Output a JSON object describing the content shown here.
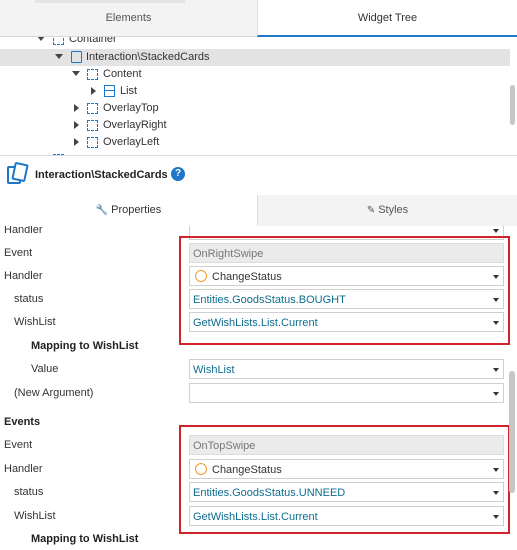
{
  "top_tabs": {
    "elements": "Elements",
    "widget_tree": "Widget Tree"
  },
  "tree": {
    "partial_top": "Container",
    "selected": "Interaction\\StackedCards",
    "content": "Content",
    "list": "List",
    "overlay_top": "OverlayTop",
    "overlay_right": "OverlayRight",
    "overlay_left": "OverlayLeft"
  },
  "widget": {
    "title": "Interaction\\StackedCards",
    "help": "?"
  },
  "prop_tabs": {
    "properties": "Properties",
    "styles": "Styles"
  },
  "props": {
    "handler_top": "Handler",
    "event1_label": "Event",
    "event1_value": "OnRightSwipe",
    "handler1_label": "Handler",
    "handler1_value": "ChangeStatus",
    "status1_label": "status",
    "status1_value": "Entities.GoodsStatus.BOUGHT",
    "wishlist1_label": "WishList",
    "wishlist1_value": "GetWishLists.List.Current",
    "mapping1_label": "Mapping to WishList",
    "value_label": "Value",
    "value_value": "WishList",
    "new_argument": "(New Argument)",
    "events_header": "Events",
    "event2_label": "Event",
    "event2_value": "OnTopSwipe",
    "handler2_label": "Handler",
    "handler2_value": "ChangeStatus",
    "status2_label": "status",
    "status2_value": "Entities.GoodsStatus.UNNEED",
    "wishlist2_label": "WishList",
    "wishlist2_value": "GetWishLists.List.Current",
    "mapping2_label": "Mapping to WishList"
  },
  "colors": {
    "accent": "#1e77c8",
    "highlight": "#d1232a",
    "action_ring": "#f19a2d",
    "expression": "#0e6d8f"
  }
}
